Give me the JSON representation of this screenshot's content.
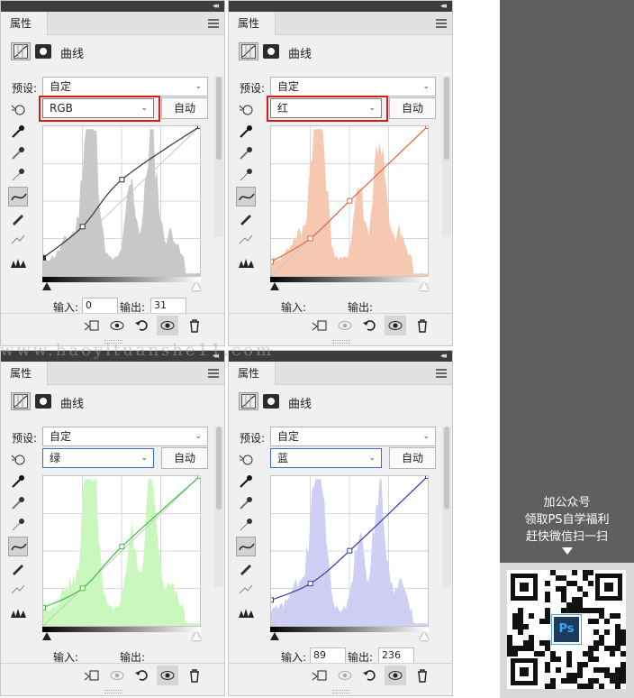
{
  "panels": [
    {
      "tab": "属性",
      "title": "曲线",
      "preset_label": "预设:",
      "preset_value": "自定",
      "channel": "RGB",
      "auto": "自动",
      "input_label": "输入:",
      "input_value": "0",
      "output_label": "输出:",
      "output_value": "31",
      "highlighted": true,
      "histogram_color": "#c8c8c8",
      "curve_color": "#333333",
      "curve_points": [
        [
          0,
          31
        ],
        [
          64,
          84
        ],
        [
          128,
          164
        ],
        [
          255,
          255
        ]
      ]
    },
    {
      "tab": "属性",
      "title": "曲线",
      "preset_label": "预设:",
      "preset_value": "自定",
      "channel": "红",
      "auto": "自动",
      "input_label": "输入:",
      "input_value": "",
      "output_label": "输出:",
      "output_value": "",
      "highlighted": true,
      "histogram_color": "#f6c8b2",
      "curve_color": "#e06a43",
      "curve_points": [
        [
          0,
          24
        ],
        [
          64,
          64
        ],
        [
          128,
          128
        ],
        [
          255,
          255
        ]
      ]
    },
    {
      "tab": "属性",
      "title": "曲线",
      "preset_label": "预设:",
      "preset_value": "自定",
      "channel": "绿",
      "auto": "自动",
      "input_label": "输入:",
      "input_value": "",
      "output_label": "输出:",
      "output_value": "",
      "highlighted": false,
      "histogram_color": "#c9f7bd",
      "curve_color": "#39c43a",
      "curve_points": [
        [
          0,
          31
        ],
        [
          64,
          64
        ],
        [
          128,
          135
        ],
        [
          255,
          255
        ]
      ]
    },
    {
      "tab": "属性",
      "title": "曲线",
      "preset_label": "预设:",
      "preset_value": "自定",
      "channel": "蓝",
      "auto": "自动",
      "input_label": "输入:",
      "input_value": "89",
      "output_label": "输出:",
      "output_value": "236",
      "highlighted": false,
      "histogram_color": "#cfcff5",
      "curve_color": "#3a3ab0",
      "curve_points": [
        [
          0,
          44
        ],
        [
          64,
          72
        ],
        [
          128,
          128
        ],
        [
          255,
          255
        ]
      ]
    }
  ],
  "watermark": "www.haoyituanshe11.com",
  "promo": {
    "line1": "加公众号",
    "line2": "领取PS自学福利",
    "line3": "赶快微信扫一扫",
    "logo": "Ps"
  }
}
